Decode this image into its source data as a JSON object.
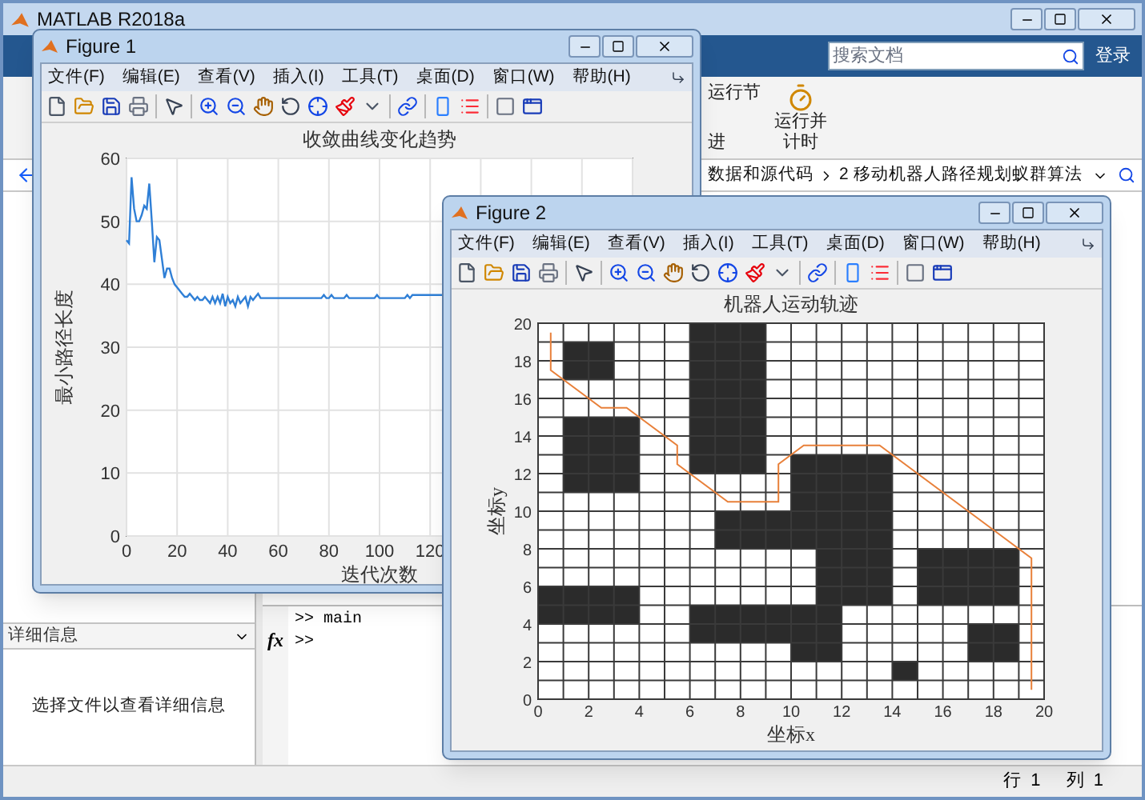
{
  "main_window": {
    "title": "MATLAB R2018a",
    "search": {
      "placeholder": "搜索文档"
    },
    "sign_in": "登录",
    "ribbon_buttons": [
      {
        "kind": "text",
        "label": "运行节"
      },
      {
        "kind": "text",
        "label": "进"
      },
      {
        "kind": "icon",
        "label": "运行并计时"
      }
    ],
    "path_bar": {
      "segments": [
        "数据和源代码",
        "2 移动机器人路径规划蚁群算法"
      ]
    },
    "details_panel": {
      "title": "详细信息",
      "message": "选择文件以查看详细信息"
    },
    "command_window": {
      "prompt_icon": "fx",
      "lines": [
        ">> main",
        ">>"
      ]
    },
    "status_bar": {
      "row": "行  1",
      "column": "列  1"
    }
  },
  "figures": [
    {
      "title": "Figure 1",
      "menu": [
        "文件(F)",
        "编辑(E)",
        "查看(V)",
        "插入(I)",
        "工具(T)",
        "桌面(D)",
        "窗口(W)",
        "帮助(H)"
      ],
      "kind": "plot",
      "chart_data": {
        "type": "line",
        "grid": true,
        "title": "收敛曲线变化趋势",
        "xlabel": "迭代次数",
        "ylabel": "最小路径长度",
        "xlim": [
          0,
          200
        ],
        "ylim": [
          0,
          60
        ],
        "xticks": [
          0,
          20,
          40,
          60,
          80,
          100,
          120
        ],
        "yticks": [
          0,
          10,
          20,
          30,
          40,
          50,
          60
        ],
        "x": [
          0,
          1,
          2,
          3,
          4,
          5,
          6,
          7,
          8,
          9,
          10,
          11,
          12,
          13,
          14,
          15,
          16,
          17,
          18,
          19,
          20,
          21,
          22,
          23,
          24,
          25,
          26,
          27,
          28,
          29,
          30,
          31,
          32,
          33,
          34,
          35,
          36,
          37,
          38,
          39,
          40,
          41,
          42,
          43,
          44,
          45,
          46,
          47,
          48,
          49,
          50,
          51,
          52,
          53,
          60,
          77,
          78,
          79,
          80,
          81,
          82,
          86,
          87,
          88,
          98,
          99,
          100,
          110,
          111,
          112,
          113,
          125
        ],
        "series": [
          {
            "color": "#2f7fd6",
            "values": [
              47,
              46.5,
              57,
              52,
              50,
              50,
              51,
              52.5,
              52,
              56,
              50,
              43.5,
              47.5,
              47,
              44,
              41,
              42.5,
              42.5,
              41,
              40,
              39.5,
              39,
              38.5,
              38,
              38,
              38.5,
              38,
              37.5,
              38,
              37.5,
              37.5,
              38,
              37.5,
              37,
              38,
              37,
              38,
              37,
              38.5,
              36.5,
              38,
              37,
              37.5,
              36.5,
              38,
              37,
              37.5,
              38,
              36.5,
              38,
              37.5,
              38,
              38.5,
              37.8,
              37.8,
              37.8,
              38.3,
              37.8,
              37.8,
              38.3,
              37.8,
              37.8,
              38.3,
              37.8,
              37.8,
              38.3,
              37.8,
              37.8,
              38.3,
              37.8,
              38.3,
              38.3
            ]
          }
        ]
      }
    },
    {
      "title": "Figure 2",
      "menu": [
        "文件(F)",
        "编辑(E)",
        "查看(V)",
        "插入(I)",
        "工具(T)",
        "桌面(D)",
        "窗口(W)",
        "帮助(H)"
      ],
      "kind": "map",
      "chart_data": {
        "type": "line",
        "grid": true,
        "title": "机器人运动轨迹",
        "xlabel": "坐标x",
        "ylabel": "坐标y",
        "xlim": [
          0,
          20
        ],
        "ylim": [
          0,
          20
        ],
        "xticks": [
          0,
          2,
          4,
          6,
          8,
          10,
          12,
          14,
          16,
          18,
          20
        ],
        "yticks": [
          0,
          2,
          4,
          6,
          8,
          10,
          12,
          14,
          16,
          18,
          20
        ],
        "x": [
          0.5,
          0.5,
          2.5,
          3.5,
          5.5,
          5.5,
          7.5,
          9.5,
          9.5,
          10.5,
          13.5,
          18.5,
          19.5,
          19.5
        ],
        "series": [
          {
            "color": "#e8803a",
            "values": [
              19.5,
              17.5,
              15.5,
              15.5,
              13.5,
              12.5,
              10.5,
              10.5,
              12.5,
              13.5,
              13.5,
              8.5,
              7.5,
              0.5
            ]
          }
        ]
      }
    }
  ]
}
